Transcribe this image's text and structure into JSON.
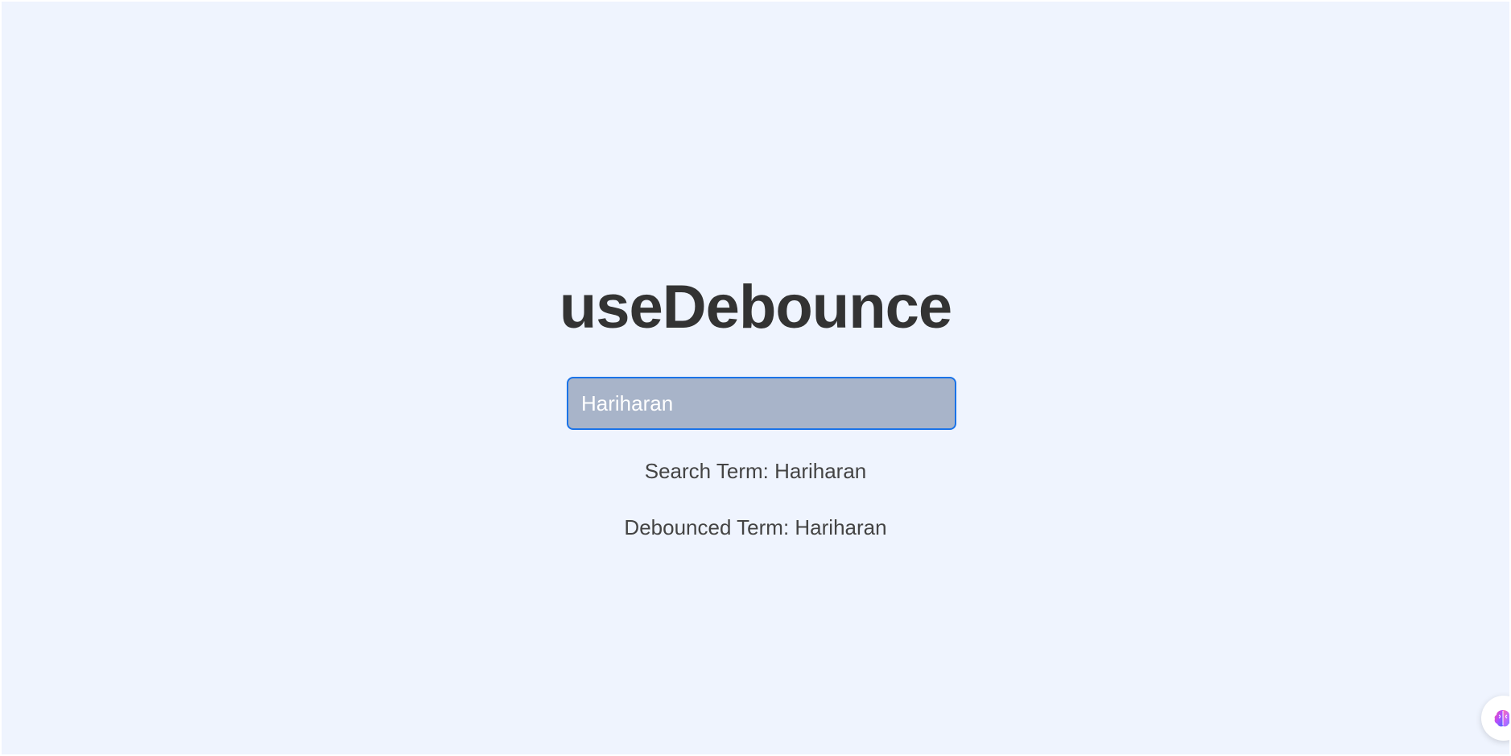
{
  "page": {
    "title": "useDebounce"
  },
  "search": {
    "value": "Hariharan",
    "placeholder": ""
  },
  "results": {
    "search_term": "Search Term: Hariharan",
    "debounced_term": "Debounced Term: Hariharan"
  },
  "widget": {
    "icon": "brain-icon"
  },
  "colors": {
    "background": "#eff4fe",
    "input_border": "#1a73e8",
    "input_fill": "#a8b4c9",
    "title": "#333333",
    "text": "#444444"
  }
}
